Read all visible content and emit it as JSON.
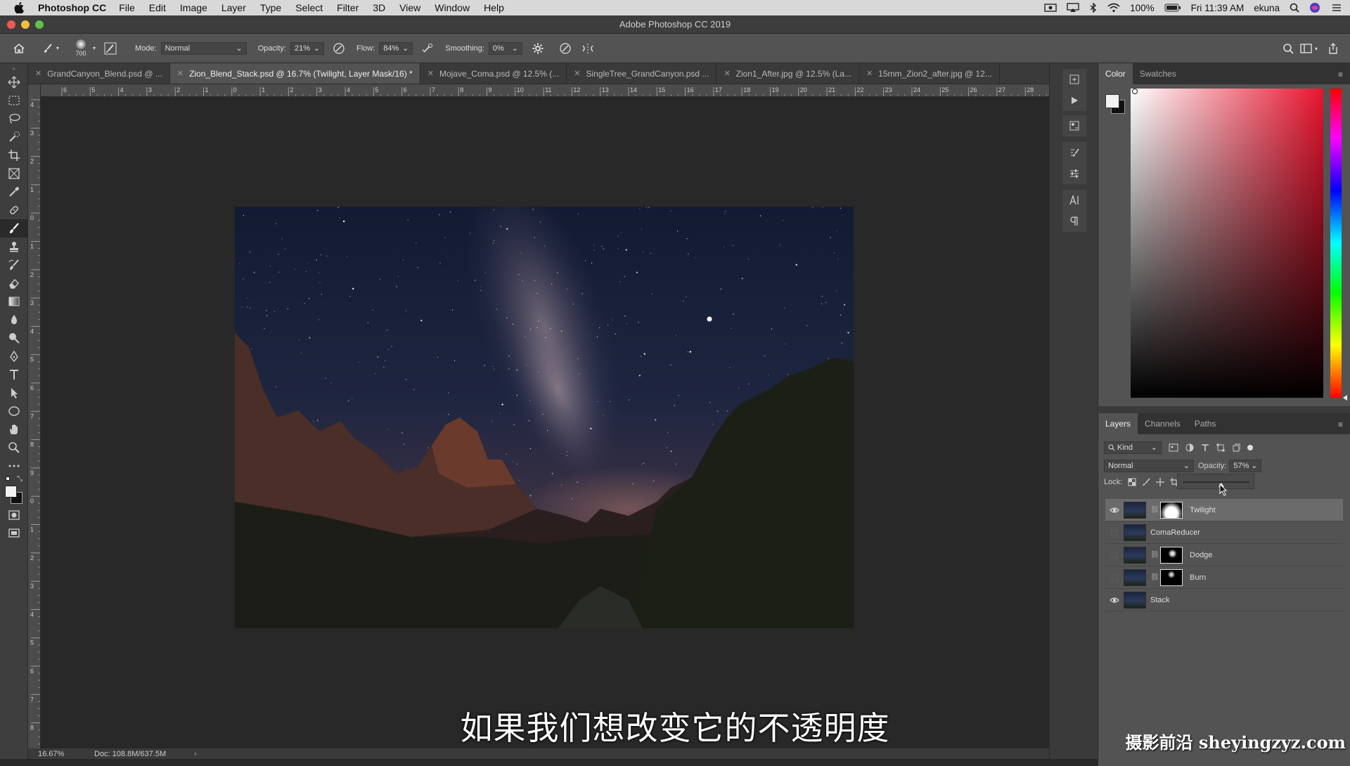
{
  "menubar": {
    "app_name": "Photoshop CC",
    "items": [
      "File",
      "Edit",
      "Image",
      "Layer",
      "Type",
      "Select",
      "Filter",
      "3D",
      "View",
      "Window",
      "Help"
    ],
    "battery": "100%",
    "clock": "Fri 11:39 AM",
    "user": "ekuna"
  },
  "window": {
    "title": "Adobe Photoshop CC 2019"
  },
  "options": {
    "brush_size": "700",
    "mode_label": "Mode:",
    "mode_value": "Normal",
    "opacity_label": "Opacity:",
    "opacity_value": "21%",
    "flow_label": "Flow:",
    "flow_value": "84%",
    "smoothing_label": "Smoothing:",
    "smoothing_value": "0%"
  },
  "tabs": [
    {
      "label": "GrandCanyon_Blend.psd @ ..."
    },
    {
      "label": "Zion_Blend_Stack.psd @ 16.7% (Twilight, Layer Mask/16) *"
    },
    {
      "label": "Mojave_Coma.psd @ 12.5% (..."
    },
    {
      "label": "SingleTree_GrandCanyon.psd ..."
    },
    {
      "label": "Zion1_After.jpg @ 12.5% (La..."
    },
    {
      "label": "15mm_Zion2_after.jpg @ 12..."
    }
  ],
  "ruler_h": [
    "6",
    "5",
    "4",
    "3",
    "2",
    "1",
    "0",
    "1",
    "2",
    "3",
    "4",
    "5",
    "6",
    "7",
    "8",
    "9",
    "10",
    "11",
    "12",
    "13",
    "14",
    "15",
    "16",
    "17",
    "18",
    "19",
    "20",
    "21",
    "22",
    "23",
    "24",
    "25",
    "26",
    "27",
    "28"
  ],
  "ruler_v": [
    "4",
    "3",
    "2",
    "1",
    "0",
    "1",
    "2",
    "3",
    "4",
    "5",
    "6",
    "7",
    "8",
    "9",
    "0",
    "1",
    "2",
    "3",
    "4",
    "5",
    "6",
    "7",
    "8"
  ],
  "status": {
    "zoom": "16.67%",
    "doc": "Doc: 108.8M/637.5M"
  },
  "color_panel": {
    "tabs": [
      "Color",
      "Swatches"
    ],
    "hue_color": "#e8142e"
  },
  "layers_panel": {
    "tabs": [
      "Layers",
      "Channels",
      "Paths"
    ],
    "filter_kind": "Kind",
    "blend_mode": "Normal",
    "opacity_label": "Opacity:",
    "opacity_value": "57%",
    "lock_label": "Lock:",
    "opacity_slider_level": 0.57,
    "layers": [
      {
        "name": "Twilight",
        "visible": true,
        "has_mask": true,
        "selected": true
      },
      {
        "name": "ComaReducer",
        "visible": false,
        "has_mask": false,
        "selected": false
      },
      {
        "name": "Dodge",
        "visible": false,
        "has_mask": true,
        "selected": false
      },
      {
        "name": "Burn",
        "visible": false,
        "has_mask": true,
        "selected": false
      },
      {
        "name": "Stack",
        "visible": true,
        "has_mask": false,
        "selected": false
      }
    ]
  },
  "subtitle": "如果我们想改变它的不透明度",
  "watermark": "摄影前沿 sheyingzyz.com"
}
